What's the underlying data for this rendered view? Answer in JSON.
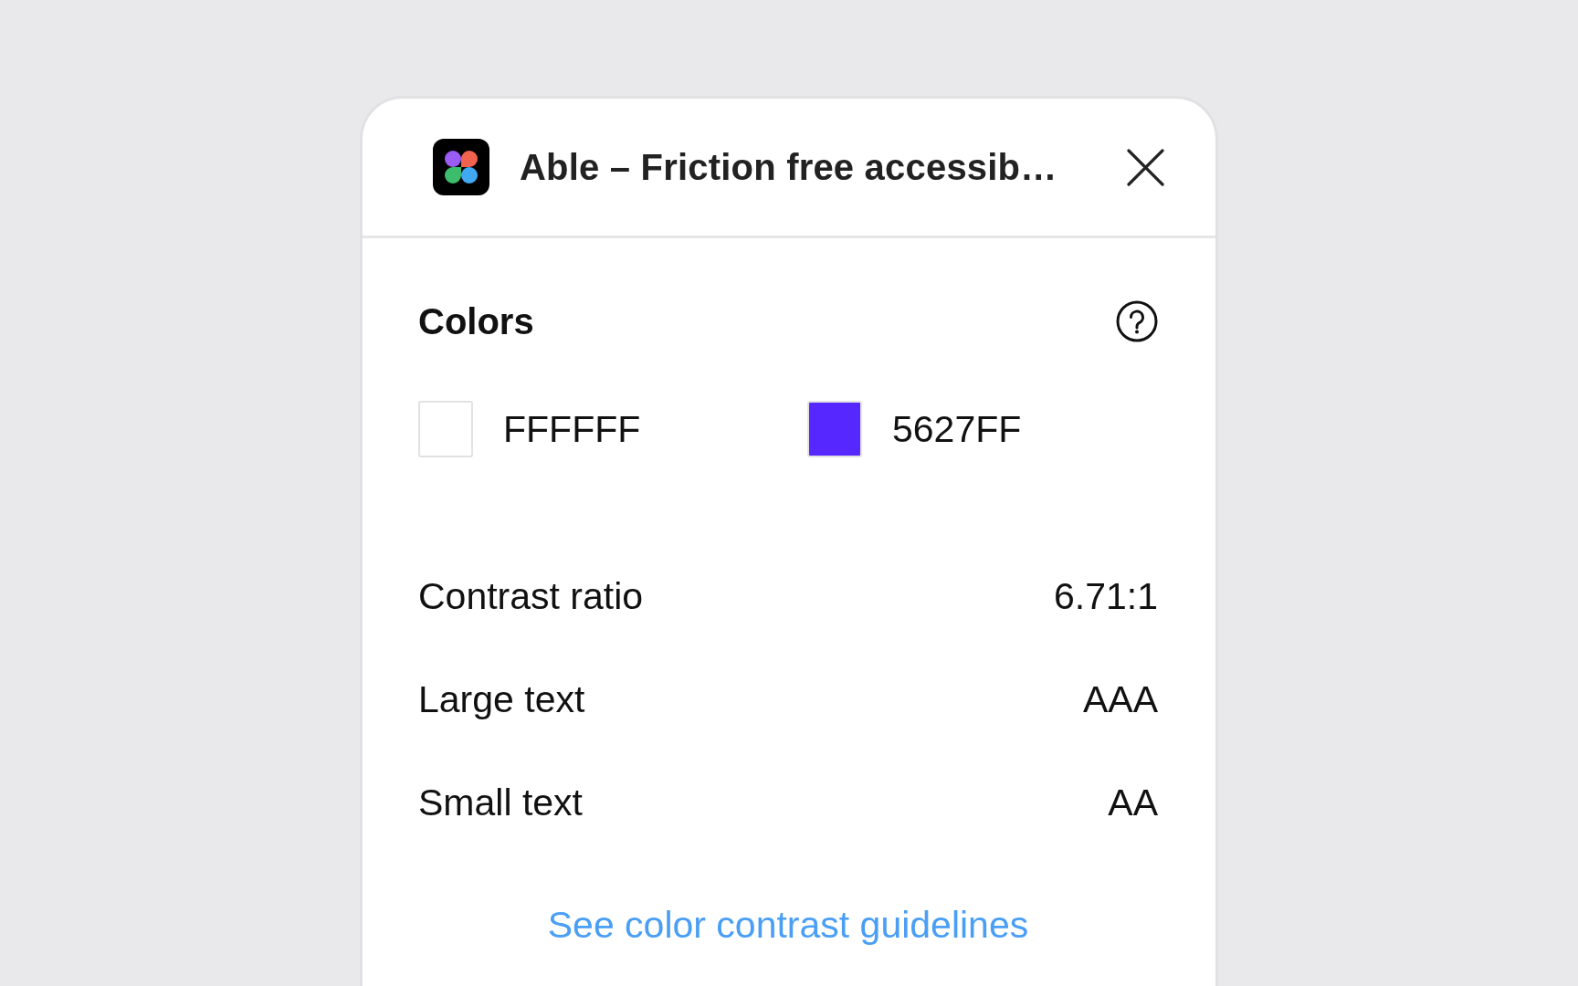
{
  "panel": {
    "title": "Able – Friction free accessib…"
  },
  "colors_section": {
    "heading": "Colors",
    "swatches": [
      {
        "value": "FFFFFF",
        "color": "#ffffff"
      },
      {
        "value": "5627FF",
        "color": "#5627ff"
      }
    ]
  },
  "metrics": [
    {
      "label": "Contrast ratio",
      "value": "6.71:1"
    },
    {
      "label": "Large text",
      "value": "AAA"
    },
    {
      "label": "Small text",
      "value": "AA"
    }
  ],
  "link": "See color contrast guidelines"
}
